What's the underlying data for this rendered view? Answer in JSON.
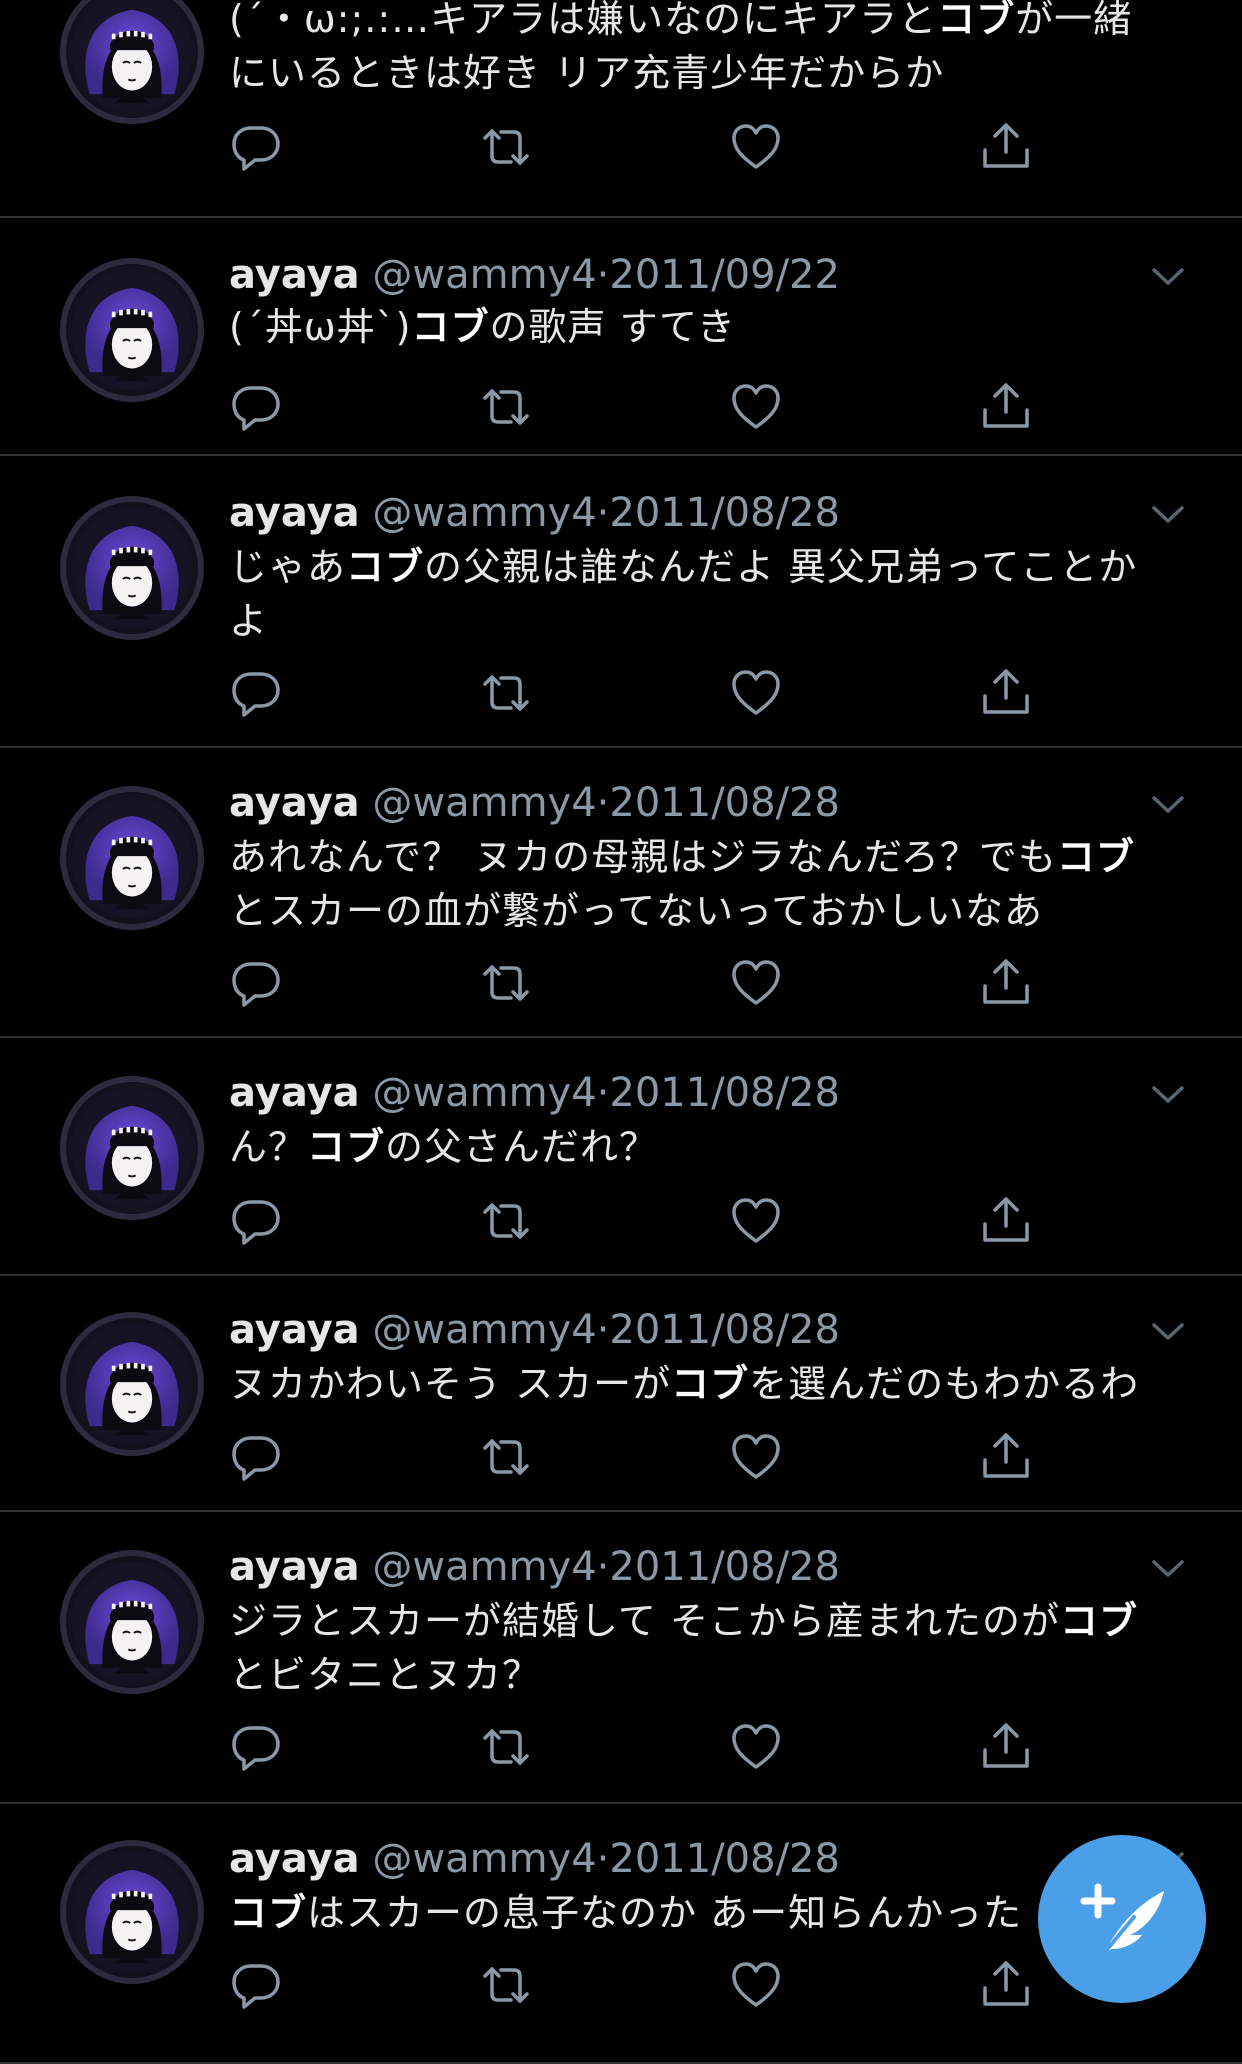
{
  "accent_color": "#4a9fe8",
  "compose_button": {
    "icon": "compose-feather-icon"
  },
  "tweets": [
    {
      "name": "",
      "handle": "",
      "date": "",
      "text_parts": [
        {
          "t": "(´・ω:;.:…キアラは嫌いなのにキアラと",
          "b": false
        },
        {
          "t": "コブ",
          "b": true
        },
        {
          "t": "が一緒にいるときは好き リア充青少年だからか",
          "b": false
        }
      ]
    },
    {
      "name": "ayaya",
      "handle": "@wammy4",
      "sep": "·",
      "date": "2011/09/22",
      "text_parts": [
        {
          "t": "(´丼ω丼`)",
          "b": false
        },
        {
          "t": "コブ",
          "b": true
        },
        {
          "t": "の歌声 すてき",
          "b": false
        }
      ]
    },
    {
      "name": "ayaya",
      "handle": "@wammy4",
      "sep": "·",
      "date": "2011/08/28",
      "text_parts": [
        {
          "t": "じゃあ",
          "b": false
        },
        {
          "t": "コブ",
          "b": true
        },
        {
          "t": "の父親は誰なんだよ 異父兄弟ってことかよ",
          "b": false
        }
      ]
    },
    {
      "name": "ayaya",
      "handle": "@wammy4",
      "sep": "·",
      "date": "2011/08/28",
      "text_parts": [
        {
          "t": "あれなんで？ ヌカの母親はジラなんだろ？でも",
          "b": false
        },
        {
          "t": "コブ",
          "b": true
        },
        {
          "t": "とスカーの血が繋がってないっておかしいなあ",
          "b": false
        }
      ]
    },
    {
      "name": "ayaya",
      "handle": "@wammy4",
      "sep": "·",
      "date": "2011/08/28",
      "text_parts": [
        {
          "t": "ん？",
          "b": false
        },
        {
          "t": "コブ",
          "b": true
        },
        {
          "t": "の父さんだれ？",
          "b": false
        }
      ]
    },
    {
      "name": "ayaya",
      "handle": "@wammy4",
      "sep": "·",
      "date": "2011/08/28",
      "text_parts": [
        {
          "t": "ヌカかわいそう スカーが",
          "b": false
        },
        {
          "t": "コブ",
          "b": true
        },
        {
          "t": "を選んだのもわかるわ",
          "b": false
        }
      ]
    },
    {
      "name": "ayaya",
      "handle": "@wammy4",
      "sep": "·",
      "date": "2011/08/28",
      "text_parts": [
        {
          "t": "ジラとスカーが結婚して そこから産まれたのが",
          "b": false
        },
        {
          "t": "コブ",
          "b": true
        },
        {
          "t": "とビタニとヌカ？",
          "b": false
        }
      ]
    },
    {
      "name": "ayaya",
      "handle": "@wammy4",
      "sep": "·",
      "date": "2011/08/28",
      "text_parts": [
        {
          "t": "コブ",
          "b": true
        },
        {
          "t": "はスカーの息子なのか あー知らんかった",
          "b": false
        }
      ]
    }
  ]
}
